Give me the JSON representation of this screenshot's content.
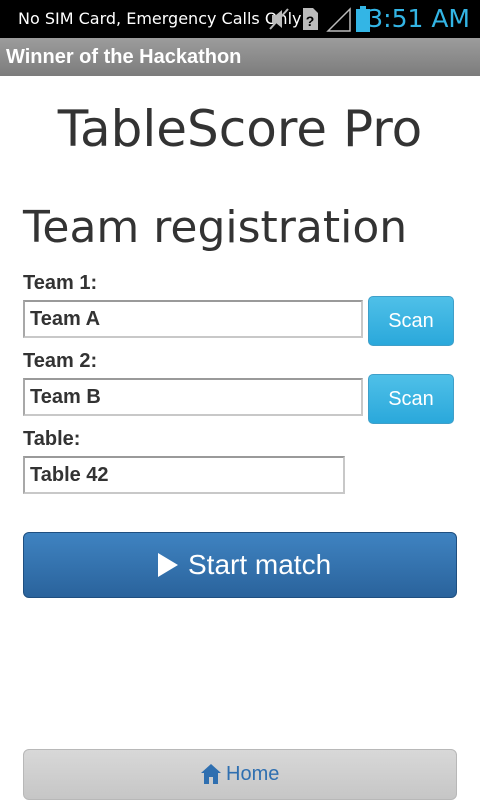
{
  "status_bar": {
    "carrier_text": "No SIM Card, Emergency Calls Only",
    "time": "3:51 AM",
    "icons": [
      "muted-icon",
      "no-sim-icon",
      "signal-icon",
      "battery-icon"
    ],
    "time_color": "#33b5e5"
  },
  "title_bar": {
    "title": "Winner of the Hackathon"
  },
  "app": {
    "title": "TableScore Pro",
    "section_title": "Team registration"
  },
  "form": {
    "team1": {
      "label": "Team 1:",
      "value": "Team A",
      "scan_label": "Scan"
    },
    "team2": {
      "label": "Team 2:",
      "value": "Team B",
      "scan_label": "Scan"
    },
    "table": {
      "label": "Table:",
      "value": "Table 42"
    }
  },
  "actions": {
    "start_label": "Start match",
    "start_icon": "play-icon",
    "home_label": "Home",
    "home_icon": "home-icon"
  },
  "colors": {
    "scan_button": "#2aa8db",
    "start_button": "#2a639c",
    "home_text": "#2f6fb0"
  }
}
